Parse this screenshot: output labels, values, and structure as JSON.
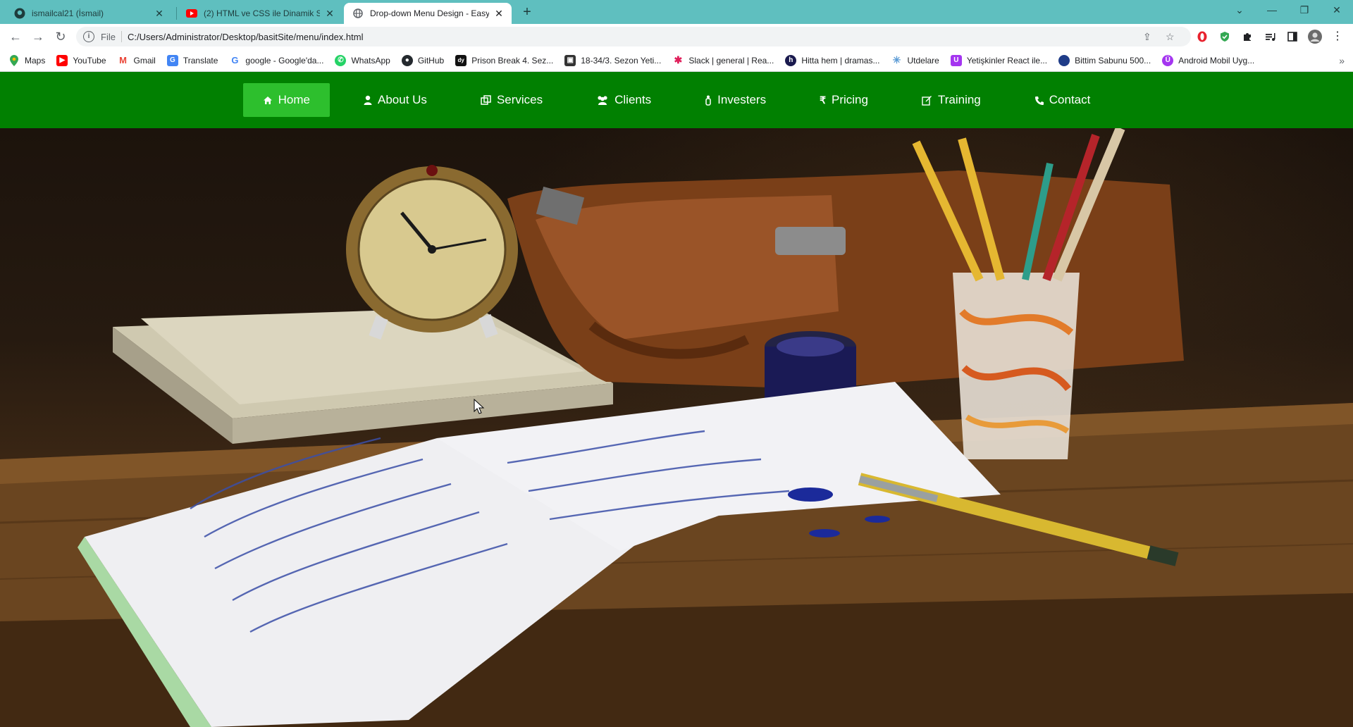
{
  "browser": {
    "tabs": [
      {
        "title": "ismailcal21 (İsmail)",
        "icon": "github-icon"
      },
      {
        "title": "(2) HTML ve CSS ile Dinamik Slider",
        "icon": "youtube-icon"
      },
      {
        "title": "Drop-down Menu Design - Easy",
        "icon": "globe-icon"
      }
    ],
    "address": {
      "scheme": "File",
      "url": "C:/Users/Administrator/Desktop/basitSite/menu/index.html"
    },
    "bookmarks": [
      {
        "label": "Maps",
        "icon": "maps-icon",
        "color": "#34a853"
      },
      {
        "label": "YouTube",
        "icon": "youtube-icon",
        "color": "#ff0000"
      },
      {
        "label": "Gmail",
        "icon": "gmail-icon",
        "color": "#ea4335"
      },
      {
        "label": "Translate",
        "icon": "translate-icon",
        "color": "#4285f4"
      },
      {
        "label": "google - Google'da...",
        "icon": "google-icon",
        "color": "#4285f4"
      },
      {
        "label": "WhatsApp",
        "icon": "whatsapp-icon",
        "color": "#25d366"
      },
      {
        "label": "GitHub",
        "icon": "github-icon",
        "color": "#24292e"
      },
      {
        "label": "Prison Break 4. Sez...",
        "icon": "dizi-icon",
        "color": "#111111"
      },
      {
        "label": "18-34/3. Sezon Yeti...",
        "icon": "image-icon",
        "color": "#333333"
      },
      {
        "label": "Slack | general | Rea...",
        "icon": "slack-icon",
        "color": "#e01e5a"
      },
      {
        "label": "Hitta hem | dramas...",
        "icon": "hitta-icon",
        "color": "#1a1a4e"
      },
      {
        "label": "Utdelare",
        "icon": "utdelare-icon",
        "color": "#5b9bd5"
      },
      {
        "label": "Yetişkinler React ile...",
        "icon": "udemy-icon",
        "color": "#a435f0"
      },
      {
        "label": "Bittim Sabunu 500...",
        "icon": "sabun-icon",
        "color": "#1f3c88"
      },
      {
        "label": "Android Mobil Uyg...",
        "icon": "android-icon",
        "color": "#a435f0"
      }
    ]
  },
  "nav": {
    "items": [
      {
        "label": "Home",
        "icon": "home-icon",
        "active": true
      },
      {
        "label": "About Us",
        "icon": "user-icon",
        "active": false
      },
      {
        "label": "Services",
        "icon": "clone-icon",
        "active": false
      },
      {
        "label": "Clients",
        "icon": "users-icon",
        "active": false
      },
      {
        "label": "Investers",
        "icon": "investors-icon",
        "active": false
      },
      {
        "label": "Pricing",
        "icon": "rupee-icon",
        "active": false
      },
      {
        "label": "Training",
        "icon": "edit-icon",
        "active": false
      },
      {
        "label": "Contact",
        "icon": "phone-icon",
        "active": false
      }
    ],
    "colors": {
      "bar": "#018001",
      "active": "#2dbf2d",
      "text": "#ffffff"
    }
  },
  "hero": {
    "description_icon": "desk-still-life-image"
  }
}
